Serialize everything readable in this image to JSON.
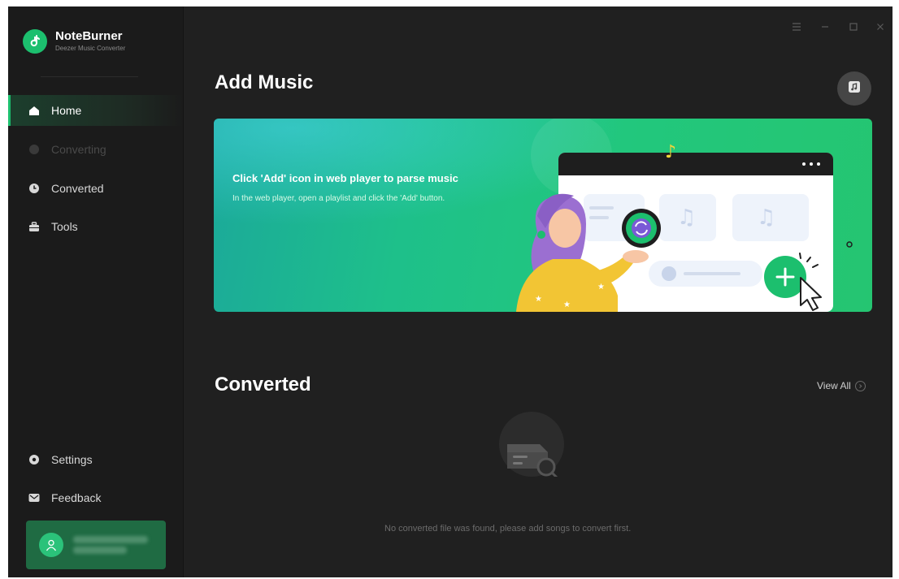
{
  "app": {
    "name": "NoteBurner",
    "subtitle": "Deezer Music Converter"
  },
  "sidebar": {
    "items": [
      {
        "label": "Home",
        "icon": "home-icon",
        "state": "active"
      },
      {
        "label": "Converting",
        "icon": "converting-icon",
        "state": "disabled"
      },
      {
        "label": "Converted",
        "icon": "clock-icon",
        "state": "normal"
      },
      {
        "label": "Tools",
        "icon": "toolbox-icon",
        "state": "normal"
      }
    ],
    "bottom_items": [
      {
        "label": "Settings",
        "icon": "gear-icon"
      },
      {
        "label": "Feedback",
        "icon": "mail-icon"
      }
    ]
  },
  "main": {
    "add_music_title": "Add Music",
    "banner": {
      "headline": "Click 'Add' icon in web player to parse music",
      "subtext": "In the web player, open a playlist and click the 'Add' button."
    },
    "converted_title": "Converted",
    "view_all_label": "View All",
    "empty_message": "No converted file was found, please add songs to convert first."
  },
  "colors": {
    "accent": "#1cbf6e",
    "window_bg": "#202020",
    "sidebar_bg": "#1b1b1b",
    "banner_start": "#1ba99a",
    "banner_end": "#25c571"
  }
}
